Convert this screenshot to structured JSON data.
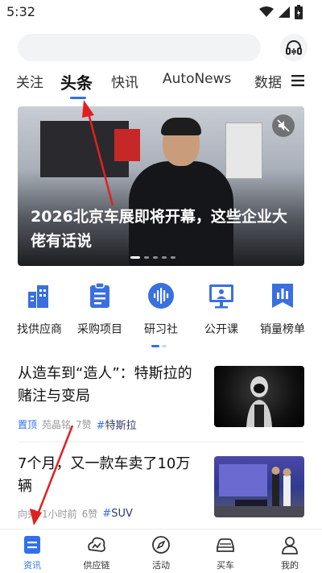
{
  "status_bar": {
    "time": "5:32",
    "icons": [
      "wifi-icon",
      "signal-icon",
      "battery-icon"
    ]
  },
  "search": {
    "placeholder": "",
    "headset_icon": "headset-icon"
  },
  "tabs": [
    {
      "label": "关注",
      "active": false
    },
    {
      "label": "头条",
      "active": true
    },
    {
      "label": "快讯",
      "active": false
    },
    {
      "label": "AutoNews",
      "active": false
    },
    {
      "label": "数据",
      "active": false
    }
  ],
  "banner": {
    "title": "2026北京车展即将开幕，这些企业大佬有话说",
    "mute_icon": "mute-icon",
    "slide_count": 5,
    "active_slide": 1
  },
  "quick_links": [
    {
      "label": "找供应商",
      "icon": "building-icon"
    },
    {
      "label": "采购项目",
      "icon": "clipboard-icon"
    },
    {
      "label": "研习社",
      "icon": "voice-wave-icon"
    },
    {
      "label": "公开课",
      "icon": "presentation-icon"
    },
    {
      "label": "销量榜单",
      "icon": "chart-bookmark-icon"
    }
  ],
  "articles": [
    {
      "title": "从造车到“造人”：特斯拉的赌注与变局",
      "pin": "置顶",
      "author": "苑晶铭",
      "likes": "7赞",
      "tag": "特斯拉"
    },
    {
      "title": "7个月，又一款车卖了10万辆",
      "pin": "",
      "author": "向秀",
      "time": "1小时前",
      "likes": "6赞",
      "tag": "SUV"
    }
  ],
  "bottom_nav": [
    {
      "label": "资讯",
      "icon": "news-icon",
      "active": true
    },
    {
      "label": "供应链",
      "icon": "supply-chain-icon",
      "active": false
    },
    {
      "label": "活动",
      "icon": "compass-icon",
      "active": false
    },
    {
      "label": "买车",
      "icon": "car-icon",
      "active": false
    },
    {
      "label": "我的",
      "icon": "user-icon",
      "active": false
    }
  ],
  "colors": {
    "accent": "#2f6ff0",
    "annotation": "#e02020"
  }
}
